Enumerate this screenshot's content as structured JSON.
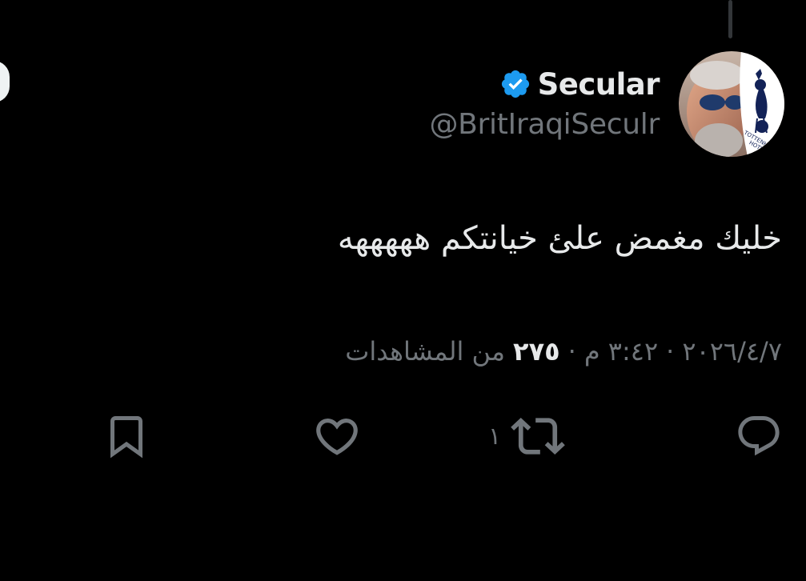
{
  "author": {
    "display_name": "Secular",
    "handle": "@BritIraqiSeculr",
    "verified": true,
    "avatar_badge_text": "TOTTENHAM HOTSPUR"
  },
  "tweet": {
    "text": "خليك مغمض علئ خيانتكم هههههه",
    "date": "٢٠٢٦/٤/٧",
    "time": "٣:٤٢ م",
    "views_count": "٢٧٥",
    "views_label": "من المشاهدات"
  },
  "actions": {
    "reply": {
      "icon": "reply-icon"
    },
    "retweet": {
      "icon": "retweet-icon",
      "count": "١"
    },
    "like": {
      "icon": "heart-icon"
    },
    "bookmark": {
      "icon": "bookmark-icon"
    }
  },
  "colors": {
    "background": "#000000",
    "primary_text": "#e7e9ea",
    "secondary_text": "#71767b",
    "verified_blue": "#1d9bf0",
    "icon_gray": "#71767b"
  }
}
